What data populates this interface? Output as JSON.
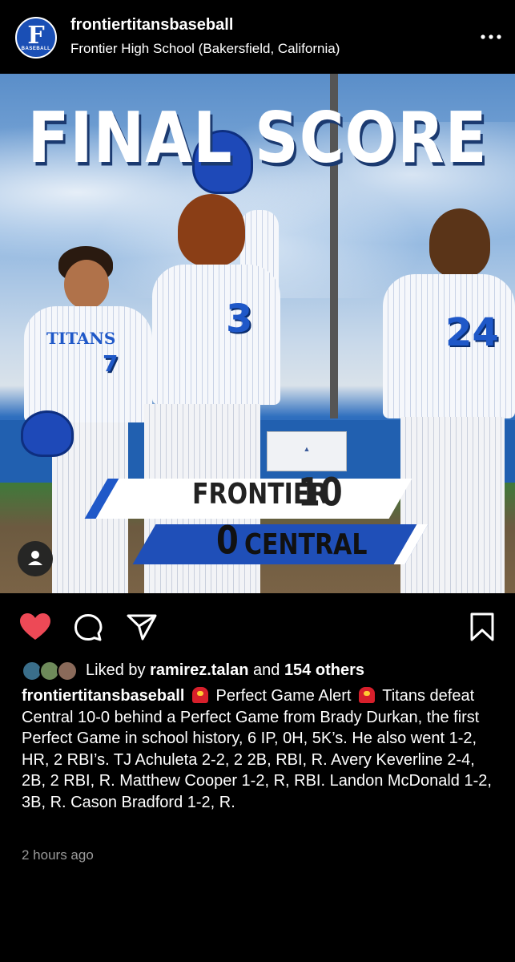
{
  "header": {
    "username": "frontiertitansbaseball",
    "location": "Frontier High School (Bakersfield, California)",
    "avatar_letter": "F",
    "avatar_sub": "BASEBALL",
    "more_icon": "more-horizontal-icon"
  },
  "image": {
    "headline": "FINAL SCORE",
    "team1": "FRONTIER",
    "score1": "10",
    "score2": "0",
    "team2": "CENTRAL",
    "jersey_left_word": "TITANS",
    "jersey_left_number": "7",
    "jersey_center_number": "3",
    "jersey_right_number": "24",
    "tag_icon": "user-tag-icon"
  },
  "actions": {
    "like_icon": "heart-filled-icon",
    "comment_icon": "comment-icon",
    "share_icon": "send-icon",
    "save_icon": "bookmark-icon",
    "like_color": "#ed4956"
  },
  "likes": {
    "prefix": "Liked by ",
    "user": "ramirez.talan",
    "middle": " and ",
    "count": "154 others"
  },
  "caption": {
    "username": "frontiertitansbaseball",
    "headline": "Perfect Game Alert",
    "body": "Titans defeat Central 10-0 behind a Perfect Game from Brady Durkan, the first Perfect Game in school history, 6 IP, 0H, 5K’s. He also went 1-2, HR, 2 RBI’s. TJ Achuleta 2-2, 2 2B, RBI, R. Avery Keverline 2-4, 2B, 2 RBI, R. Matthew Cooper 1-2, R, RBI. Landon McDonald 1-2, 3B, R. Cason Bradford 1-2, R."
  },
  "timestamp": "2 hours ago"
}
